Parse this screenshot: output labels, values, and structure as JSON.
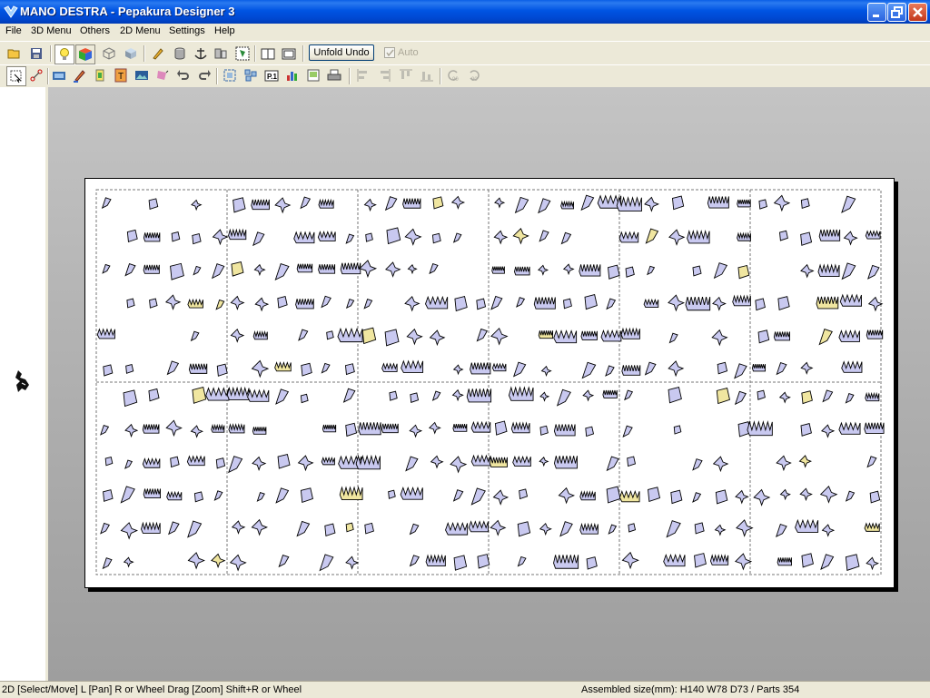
{
  "window": {
    "title": "MANO DESTRA - Pepakura Designer 3",
    "buttons": [
      "minimize",
      "maximize",
      "close"
    ]
  },
  "menubar": {
    "items": [
      "File",
      "3D Menu",
      "Others",
      "2D Menu",
      "Settings",
      "Help"
    ]
  },
  "toolbar1": {
    "icons": [
      "open-folder-icon",
      "save-icon",
      "lightbulb-icon",
      "color-cube-icon",
      "wire-cube-icon",
      "shaded-cube-icon",
      "pencil-edge-icon",
      "cylinder-icon",
      "anchor-icon",
      "move-part-icon",
      "join-faces-icon",
      "single-page-view-icon",
      "double-page-view-icon"
    ],
    "unfold_undo_label": "Unfold Undo",
    "auto_label": "Auto",
    "auto_checked": true
  },
  "toolbar2": {
    "icons": [
      "select-move-icon",
      "join-edge-icon",
      "film-icon",
      "pencil-color-icon",
      "paste-flap-icon",
      "text-tool-icon",
      "image-tool-icon",
      "rotate-3d-icon",
      "undo-icon",
      "redo-icon",
      "fit-page-icon",
      "arrange-parts-icon",
      "page-number-icon",
      "chart-icon",
      "print-preview-icon",
      "print-icon",
      "align-left-icon",
      "align-right-icon",
      "align-top-icon",
      "align-bottom-icon",
      "rotate-90-ccw-icon",
      "rotate-90-cw-icon"
    ]
  },
  "statusbar": {
    "help": "2D [Select/Move] L [Pan] R or Wheel Drag [Zoom] Shift+R or Wheel",
    "info": "Assembled size(mm): H140 W78 D73 / Parts 354"
  },
  "colors": {
    "titlebar": "#0054e3",
    "face_fill": "#c9c9f0",
    "face_fill_alt": "#f0e6a0",
    "face_stroke": "#000000"
  }
}
